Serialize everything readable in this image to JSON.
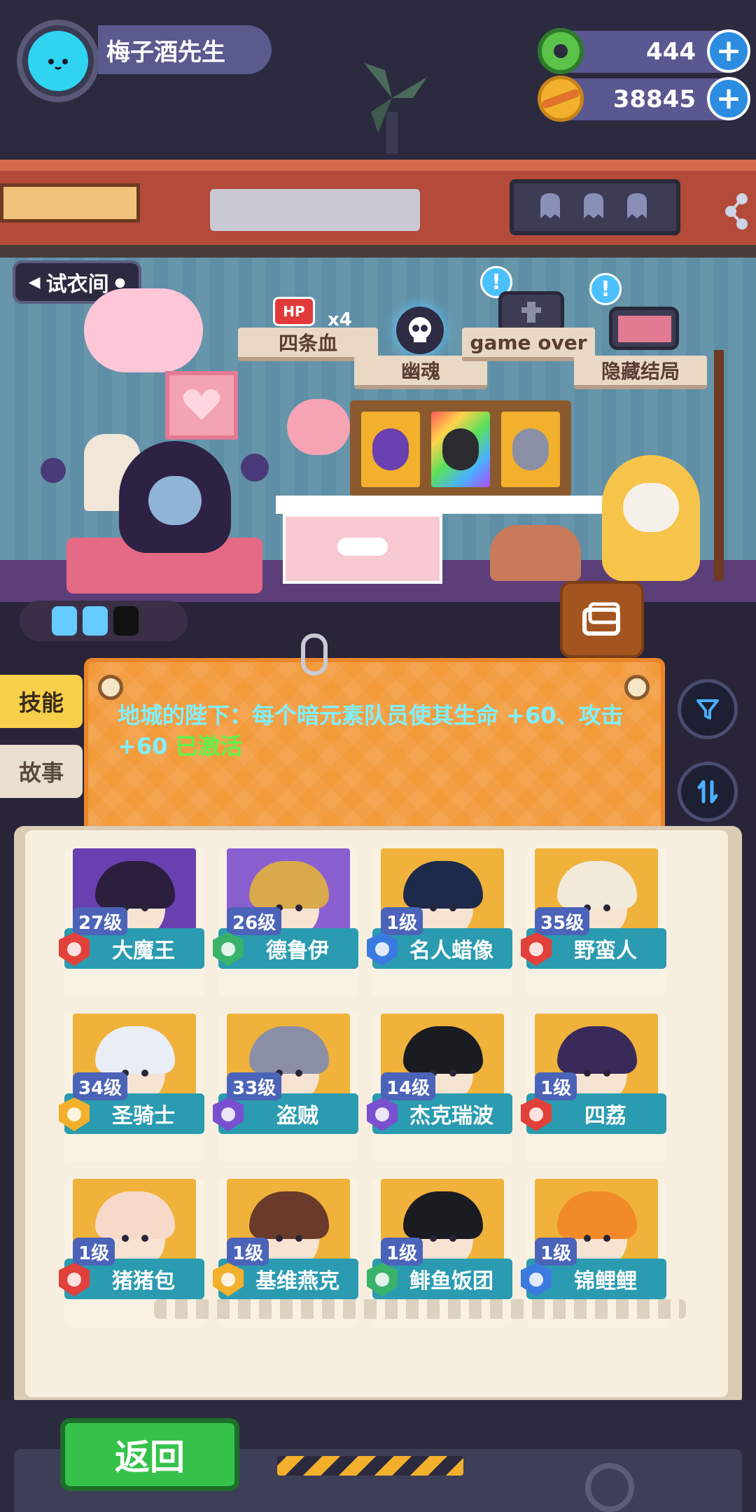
{
  "player": {
    "name": "梅子酒先生",
    "avatar_icon": "cat-face-icon"
  },
  "currencies": [
    {
      "icon": "green-donut-icon",
      "value": "444"
    },
    {
      "icon": "gold-planet-icon",
      "value": "38845"
    }
  ],
  "room": {
    "fitting_room_label": "试衣间",
    "endings": {
      "hp_badge": "HP",
      "hp_multiplier": "x4",
      "four_bars": "四条血",
      "ghost": "幽魂",
      "game_over": "game over",
      "hidden_ending": "隐藏结局"
    },
    "alert_mark": "!"
  },
  "tabs": {
    "skill": "技能",
    "story": "故事"
  },
  "skill_panel": {
    "text": "地城的陛下：每个暗元素队员使其生命 +60、攻击 +60 ",
    "status": "已激活"
  },
  "heroes": [
    {
      "level": "27级",
      "name": "大魔王",
      "badge_color": "#e2403a",
      "art_color": "#6a3fb0",
      "hair_color": "#2b1f3d"
    },
    {
      "level": "26级",
      "name": "德鲁伊",
      "badge_color": "#3ab36a",
      "art_color": "#8a5fd0",
      "hair_color": "#d9a94b"
    },
    {
      "level": "1级",
      "name": "名人蜡像",
      "badge_color": "#3a7be0",
      "art_color": "#f0b23a",
      "hair_color": "#1e2a4a"
    },
    {
      "level": "35级",
      "name": "野蛮人",
      "badge_color": "#e2403a",
      "art_color": "#f0b23a",
      "hair_color": "#f2ead8"
    },
    {
      "level": "34级",
      "name": "圣骑士",
      "badge_color": "#f2b02c",
      "art_color": "#f0b23a",
      "hair_color": "#e9edf5"
    },
    {
      "level": "33级",
      "name": "盗贼",
      "badge_color": "#7a4fd0",
      "art_color": "#f0b23a",
      "hair_color": "#8a8fa5"
    },
    {
      "level": "14级",
      "name": "杰克瑞波",
      "badge_color": "#7a4fd0",
      "art_color": "#f0b23a",
      "hair_color": "#1b1b22"
    },
    {
      "level": "1级",
      "name": "四荔",
      "badge_color": "#e2403a",
      "art_color": "#f0b23a",
      "hair_color": "#3a2a5a"
    },
    {
      "level": "1级",
      "name": "猪猪包",
      "badge_color": "#e2403a",
      "art_color": "#f0b23a",
      "hair_color": "#f7d9c9"
    },
    {
      "level": "1级",
      "name": "基维燕克",
      "badge_color": "#f2b02c",
      "art_color": "#f0b23a",
      "hair_color": "#6a3a2a"
    },
    {
      "level": "1级",
      "name": "鲱鱼饭团",
      "badge_color": "#3ab36a",
      "art_color": "#f0b23a",
      "hair_color": "#1b1b22"
    },
    {
      "level": "1级",
      "name": "锦鲤鲤",
      "badge_color": "#3a7be0",
      "art_color": "#f0b23a",
      "hair_color": "#f28a2a"
    }
  ],
  "footer": {
    "back_label": "返回"
  }
}
